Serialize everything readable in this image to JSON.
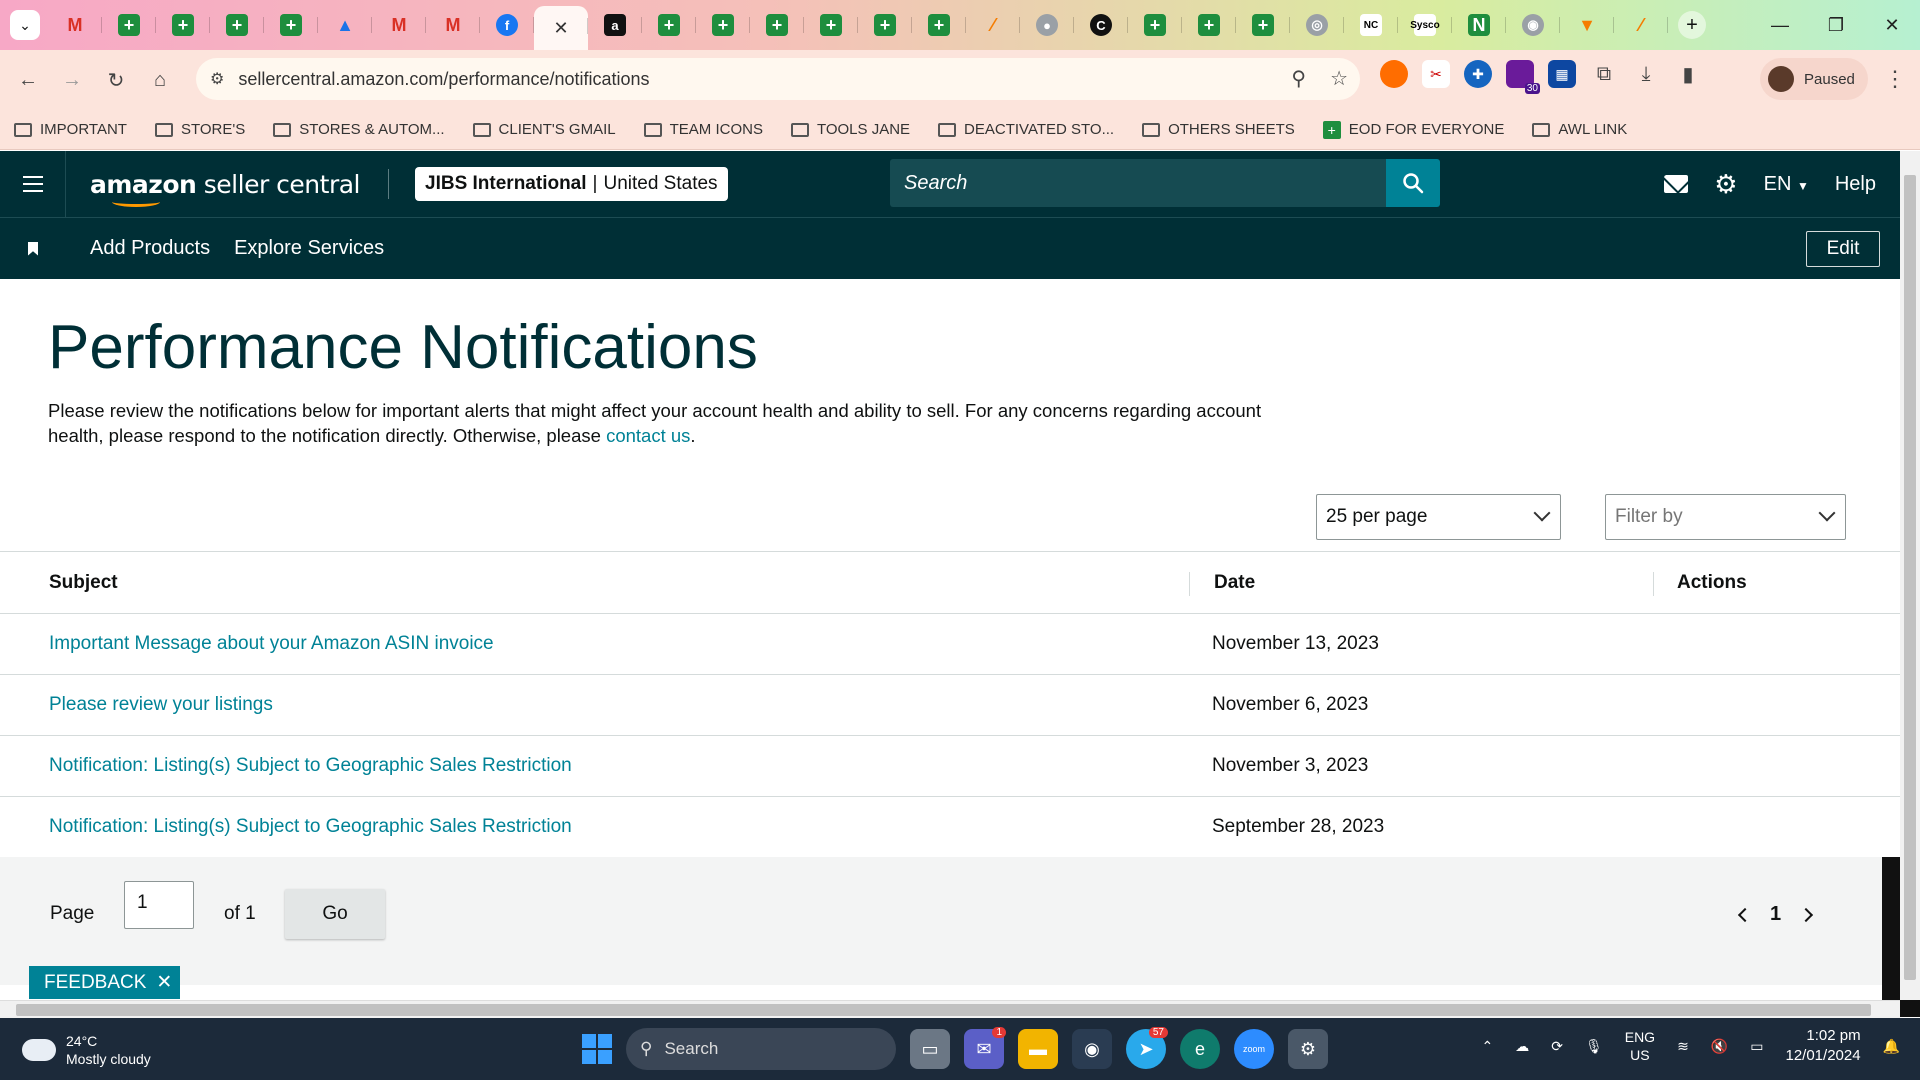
{
  "browser": {
    "tabs": [
      {
        "icon": "gmail-icon",
        "glyph": "M"
      },
      {
        "icon": "sheets-icon",
        "glyph": "+"
      },
      {
        "icon": "sheets-icon",
        "glyph": "+"
      },
      {
        "icon": "sheets-icon",
        "glyph": "+"
      },
      {
        "icon": "sheets-icon",
        "glyph": "+"
      },
      {
        "icon": "drive-icon",
        "glyph": "▲"
      },
      {
        "icon": "gmail-icon",
        "glyph": "M"
      },
      {
        "icon": "gmail-icon",
        "glyph": "M"
      },
      {
        "icon": "facebook-icon",
        "glyph": "f"
      },
      {
        "icon": "close-icon",
        "glyph": "✕",
        "active": true
      },
      {
        "icon": "amazon-icon",
        "glyph": "a"
      },
      {
        "icon": "sheets-icon",
        "glyph": "+"
      },
      {
        "icon": "sheets-icon",
        "glyph": "+"
      },
      {
        "icon": "sheets-icon",
        "glyph": "+"
      },
      {
        "icon": "sheets-icon",
        "glyph": "+"
      },
      {
        "icon": "sheets-icon",
        "glyph": "+"
      },
      {
        "icon": "sheets-icon",
        "glyph": "+"
      },
      {
        "icon": "slash-icon",
        "glyph": "⁄"
      },
      {
        "icon": "globe-icon",
        "glyph": "●"
      },
      {
        "icon": "c-icon",
        "glyph": "C"
      },
      {
        "icon": "sheets-icon",
        "glyph": "+"
      },
      {
        "icon": "sheets-icon",
        "glyph": "+"
      },
      {
        "icon": "sheets-icon",
        "glyph": "+"
      },
      {
        "icon": "car-icon",
        "glyph": "◎"
      },
      {
        "icon": "nc-icon",
        "glyph": "NC"
      },
      {
        "icon": "sysco-icon",
        "glyph": "Sysco"
      },
      {
        "icon": "n-icon",
        "glyph": "N"
      },
      {
        "icon": "circle-icon",
        "glyph": "◉"
      },
      {
        "icon": "pennant-icon",
        "glyph": "▼"
      },
      {
        "icon": "slash-icon",
        "glyph": "⁄"
      }
    ],
    "url": "sellercentral.amazon.com/performance/notifications",
    "profile_status": "Paused",
    "calendar_badge": "30",
    "bookmarks": [
      {
        "label": "IMPORTANT",
        "type": "folder"
      },
      {
        "label": "STORE'S",
        "type": "folder"
      },
      {
        "label": "STORES & AUTOM...",
        "type": "folder"
      },
      {
        "label": "CLIENT'S GMAIL",
        "type": "folder"
      },
      {
        "label": "TEAM ICONS",
        "type": "folder"
      },
      {
        "label": "TOOLS JANE",
        "type": "folder"
      },
      {
        "label": "DEACTIVATED STO...",
        "type": "folder"
      },
      {
        "label": "OTHERS SHEETS",
        "type": "folder"
      },
      {
        "label": "EOD FOR EVERYONE",
        "type": "sheet"
      },
      {
        "label": "AWL LINK",
        "type": "folder"
      }
    ]
  },
  "header": {
    "logo_main": "amazon",
    "logo_sub": " seller central",
    "store_name": "JIBS International",
    "store_separator": "|",
    "store_region": "United States",
    "search_placeholder": "Search",
    "language": "EN",
    "help": "Help"
  },
  "subnav": {
    "links": [
      "Add Products",
      "Explore Services"
    ],
    "edit": "Edit"
  },
  "main": {
    "title": "Performance Notifications",
    "intro_text": "Please review the notifications below for important alerts that might affect your account health and ability to sell. For any concerns regarding account health, please respond to the notification directly. Otherwise, please ",
    "intro_link": "contact us",
    "intro_end": ".",
    "per_page": "25 per page",
    "filter_placeholder": "Filter by",
    "table": {
      "headers": {
        "subject": "Subject",
        "date": "Date",
        "actions": "Actions"
      },
      "rows": [
        {
          "subject": "Important Message about your Amazon ASIN invoice",
          "date": "November 13, 2023"
        },
        {
          "subject": "Please review your listings",
          "date": "November 6, 2023"
        },
        {
          "subject": "Notification: Listing(s) Subject to Geographic Sales Restriction",
          "date": "November 3, 2023"
        },
        {
          "subject": "Notification: Listing(s) Subject to Geographic Sales Restriction",
          "date": "September 28, 2023"
        }
      ]
    },
    "pagination": {
      "page_label": "Page",
      "page_value": "1",
      "of_label": "of 1",
      "go": "Go",
      "current": "1"
    },
    "feedback": "FEEDBACK",
    "feedback_close": "✕"
  },
  "taskbar": {
    "temperature": "24°C",
    "weather": "Mostly cloudy",
    "search": "Search",
    "teams_badge": "1",
    "telegram_badge": "57",
    "lang_top": "ENG",
    "lang_bottom": "US",
    "time": "1:02 pm",
    "date": "12/01/2024"
  },
  "colors": {
    "amazon_header": "#002f36",
    "link_teal": "#008296",
    "search_button": "#008296",
    "logo_smile": "#ff9900"
  }
}
